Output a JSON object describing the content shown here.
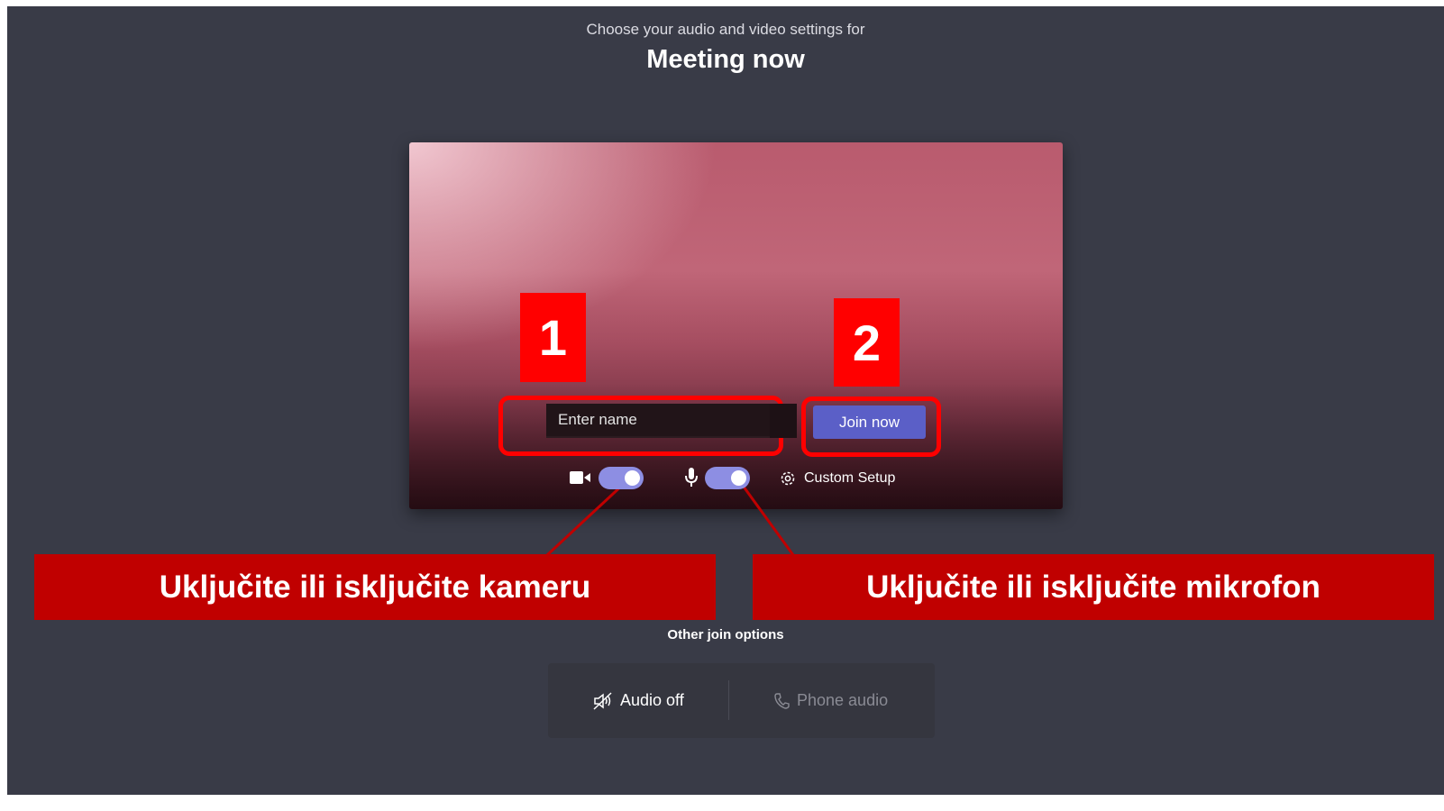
{
  "header": {
    "subtitle": "Choose your audio and video settings for",
    "meeting_title": "Meeting now"
  },
  "prejoin": {
    "name_placeholder": "Enter name",
    "join_label": "Join now",
    "camera_toggle_on": true,
    "mic_toggle_on": true,
    "custom_setup_label": "Custom Setup"
  },
  "annotations": {
    "num_1": "1",
    "num_2": "2",
    "camera_label": "Uključite ili isključite kameru",
    "mic_label": "Uključite ili isključite mikrofon"
  },
  "other_join": {
    "heading": "Other join options",
    "audio_off_label": "Audio off",
    "phone_audio_label": "Phone audio"
  },
  "colors": {
    "background": "#393b47",
    "accent": "#5b5fc7",
    "annotation_red": "#ff0000",
    "label_red": "#c00000"
  }
}
